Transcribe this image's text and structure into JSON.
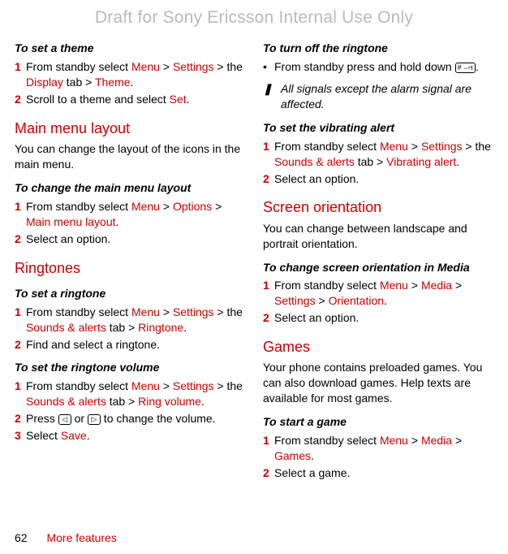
{
  "watermark": "Draft for Sony Ericsson Internal Use Only",
  "left": {
    "h_theme": "To set a theme",
    "theme_s1_a": "From standby select ",
    "theme_s1_b": " > the ",
    "theme_s1_c": " tab > ",
    "theme_s1_end": ".",
    "theme_menu": "Menu",
    "theme_settings": "Settings",
    "theme_display": "Display",
    "theme_theme": "Theme",
    "theme_s2_a": "Scroll to a theme and select ",
    "theme_s2_set": "Set",
    "theme_s2_end": ".",
    "t_mainmenu": "Main menu layout",
    "mainmenu_body": "You can change the layout of the icons in the main menu.",
    "h_changelayout": "To change the main menu layout",
    "layout_s1_a": "From standby select ",
    "layout_menu": "Menu",
    "layout_options": "Options",
    "layout_mml": "Main menu layout",
    "layout_s1_end": ".",
    "layout_s2": "Select an option.",
    "t_ringtones": "Ringtones",
    "h_setringtone": "To set a ringtone",
    "ring_s1_a": "From standby select ",
    "ring_menu": "Menu",
    "ring_settings": "Settings",
    "ring_tab": "Sounds & alerts",
    "ring_ringtone": "Ringtone",
    "ring_s1_b": " > the ",
    "ring_s1_c": " tab > ",
    "ring_s1_end": ".",
    "ring_s2": "Find and select a ringtone.",
    "h_ringvol": "To set the ringtone volume",
    "vol_s1_a": "From standby select ",
    "vol_menu": "Menu",
    "vol_settings": "Settings",
    "vol_tab": "Sounds & alerts",
    "vol_rv": "Ring volume",
    "vol_s1_b": " > the ",
    "vol_s1_c": " tab > ",
    "vol_s1_end": ".",
    "vol_s2_a": "Press ",
    "vol_s2_b": " or ",
    "vol_s2_c": " to change the volume.",
    "vol_s3_a": "Select ",
    "vol_s3_save": "Save",
    "vol_s3_end": "."
  },
  "right": {
    "h_turnoff": "To turn off the ringtone",
    "off_b1_a": "From standby press and hold down ",
    "off_b1_end": ".",
    "note": "All signals except the alarm signal are affected.",
    "h_vib": "To set the vibrating alert",
    "vib_s1_a": "From standby select ",
    "vib_menu": "Menu",
    "vib_settings": "Settings",
    "vib_tab": "Sounds & alerts",
    "vib_va": "Vibrating alert",
    "vib_s1_b": " > the ",
    "vib_s1_c": " tab > ",
    "vib_s1_end": ".",
    "vib_s2": "Select an option.",
    "t_screen": "Screen orientation",
    "screen_body": "You can change between landscape and portrait orientation.",
    "h_changescreen": "To change screen orientation in Media",
    "scr_s1_a": "From standby select ",
    "scr_menu": "Menu",
    "scr_media": "Media",
    "scr_settings": "Settings",
    "scr_orient": "Orientation",
    "scr_s1_end": ".",
    "scr_s2": "Select an option.",
    "t_games": "Games",
    "games_body": "Your phone contains preloaded games. You can also download games. Help texts are available for most games.",
    "h_startgame": "To start a game",
    "game_s1_a": "From standby select ",
    "game_menu": "Menu",
    "game_media": "Media",
    "game_games": "Games",
    "game_s1_end": ".",
    "game_s2": "Select a game."
  },
  "footer": {
    "page": "62",
    "section": "More features"
  },
  "icons": {
    "hash": "# ⌣ત",
    "left": "◁",
    "right": "▷",
    "exclaim": "❚"
  }
}
